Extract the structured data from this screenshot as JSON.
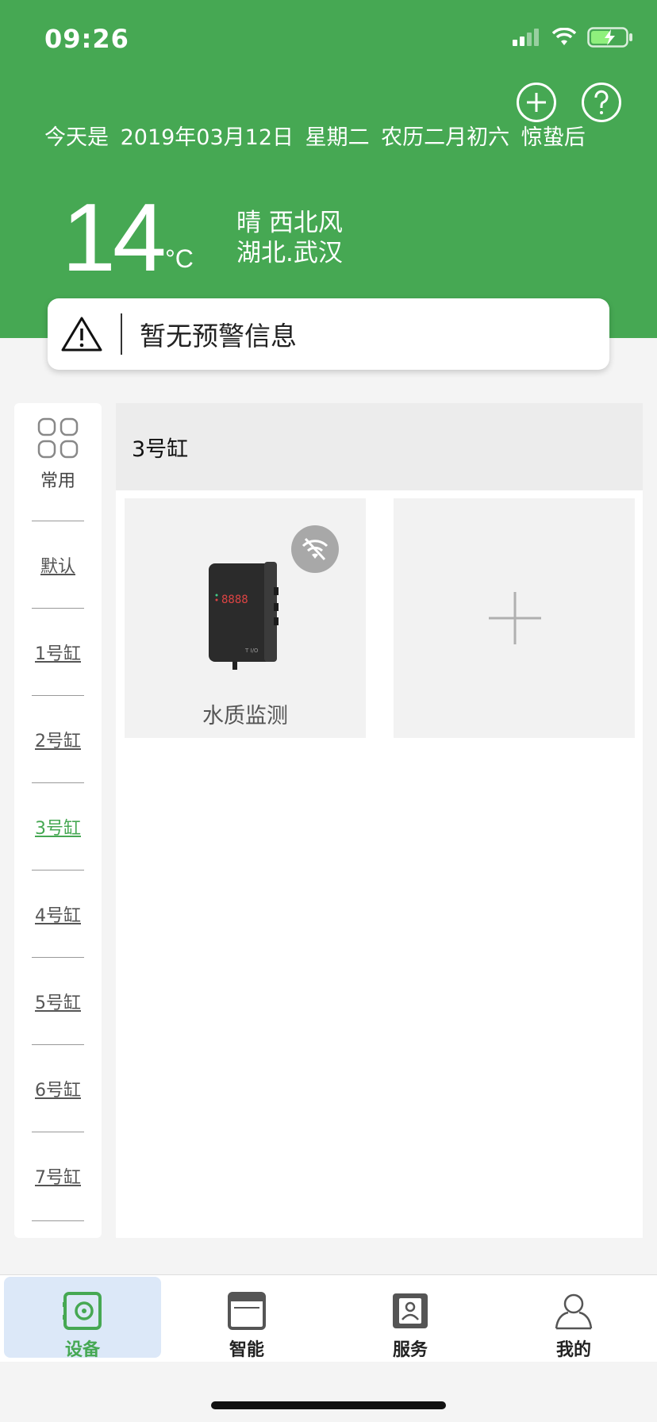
{
  "status_bar": {
    "time": "09:26"
  },
  "header": {
    "date_line": "今天是 2019年03月12日 星期二 农历二月初六 惊蛰后",
    "temperature": "14",
    "temp_unit": "°C",
    "weather": "晴 西北风",
    "location": "湖北.武汉",
    "add_icon": "plus-circle-icon",
    "help_icon": "question-circle-icon"
  },
  "alert": {
    "text": "暂无预警信息",
    "icon": "warning-triangle-icon"
  },
  "sidebar": {
    "common_label": "常用",
    "items": [
      {
        "label": "默认",
        "active": false
      },
      {
        "label": "1号缸",
        "active": false
      },
      {
        "label": "2号缸",
        "active": false
      },
      {
        "label": "3号缸",
        "active": true
      },
      {
        "label": "4号缸",
        "active": false
      },
      {
        "label": "5号缸",
        "active": false
      },
      {
        "label": "6号缸",
        "active": false
      },
      {
        "label": "7号缸",
        "active": false
      }
    ]
  },
  "panel": {
    "title": "3号缸",
    "devices": [
      {
        "label": "水质监测",
        "status_icon": "wifi-off-icon",
        "display": "8888"
      }
    ],
    "add_icon": "plus-icon"
  },
  "bottom_nav": [
    {
      "label": "设备",
      "icon": "device-safe-icon",
      "active": true
    },
    {
      "label": "智能",
      "icon": "window-icon",
      "active": false
    },
    {
      "label": "服务",
      "icon": "contact-card-icon",
      "active": false
    },
    {
      "label": "我的",
      "icon": "user-icon",
      "active": false
    }
  ],
  "colors": {
    "primary": "#46a853",
    "active_tab_bg": "#dce8f8"
  }
}
